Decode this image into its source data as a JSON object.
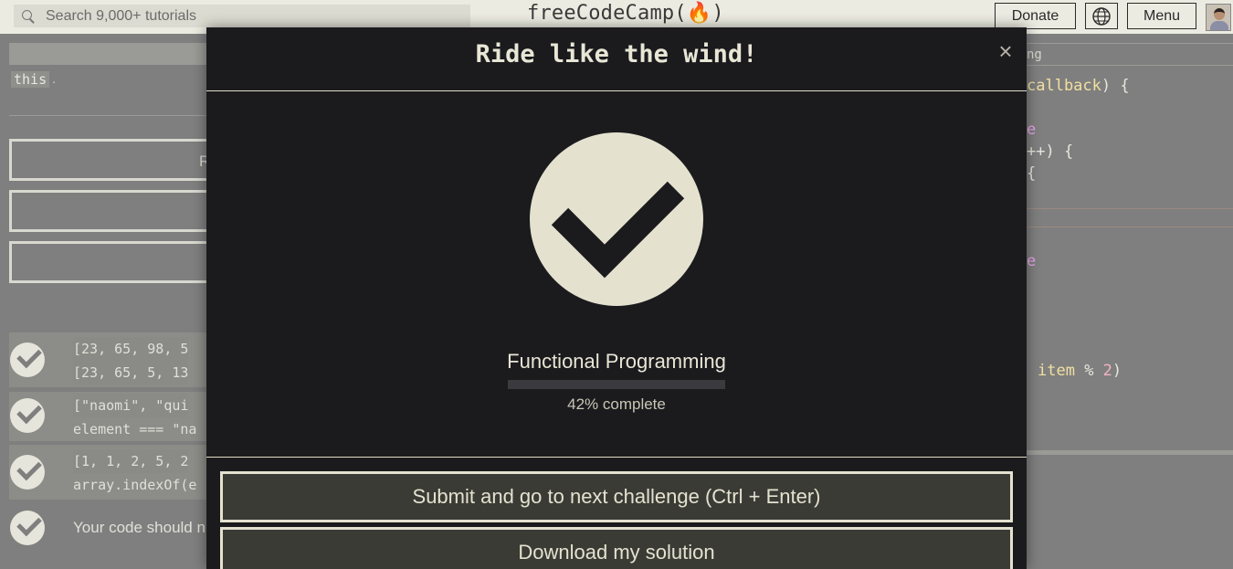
{
  "nav": {
    "search_placeholder": "Search 9,000+ tutorials",
    "logo_text": "freeCodeCamp(🔥)",
    "donate_label": "Donate",
    "language_icon": "globe-icon",
    "menu_label": "Menu"
  },
  "background": {
    "code_this": "this",
    "code_this_suffix": ".",
    "button_1_partial": "R",
    "tests": [
      {
        "line1": "[23, 65, 98, 5",
        "line2": "[23, 65, 5, 13"
      },
      {
        "line1": "[\"naomi\", \"qui",
        "line2": "element === \"na"
      },
      {
        "line1": "[1, 1, 2, 5, 2",
        "line2": "array.indexOf(e"
      },
      {
        "text": "Your code should n"
      }
    ],
    "editor": {
      "tab_text": "ng",
      "line_callback": "callback",
      "line_callback_rest": ") {",
      "line_e1": "e",
      "line_pp": "++) {",
      "line_brace": "{",
      "line_e2": "e",
      "line_item_kw": "item",
      "line_item_op": " % ",
      "line_item_num": "2",
      "line_item_close": ")"
    }
  },
  "modal": {
    "title": "Ride like the wind!",
    "close_symbol": "×",
    "check_icon": "checkmark-icon",
    "block_name": "Functional Programming",
    "progress_percent": 42,
    "progress_text": "42% complete",
    "submit_label": "Submit and go to next challenge (Ctrl + Enter)",
    "download_label": "Download my solution"
  },
  "colors": {
    "modal_bg": "#1b1b1e",
    "accent_cream": "#e4e2cf",
    "button_bg": "#3b3b36",
    "nav_bg": "#ecebe1"
  }
}
